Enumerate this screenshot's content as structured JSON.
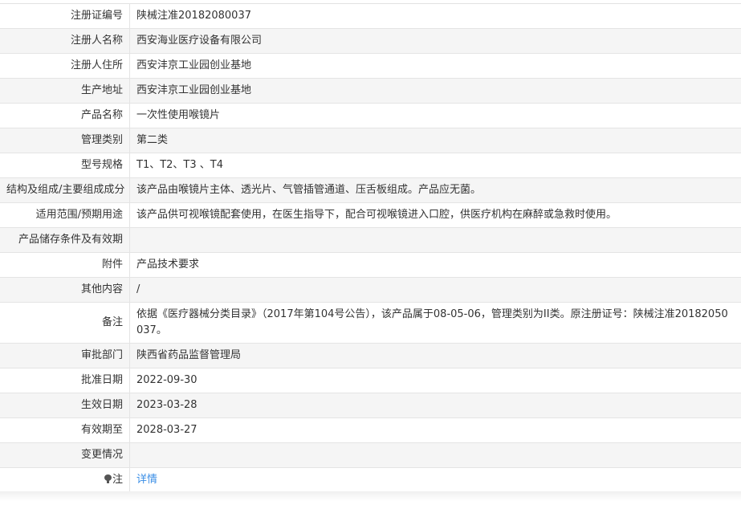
{
  "rows": [
    {
      "label": "注册证编号",
      "value": "陕械注准20182080037"
    },
    {
      "label": "注册人名称",
      "value": "西安海业医疗设备有限公司"
    },
    {
      "label": "注册人住所",
      "value": "西安沣京工业园创业基地"
    },
    {
      "label": "生产地址",
      "value": "西安沣京工业园创业基地"
    },
    {
      "label": "产品名称",
      "value": "一次性使用喉镜片"
    },
    {
      "label": "管理类别",
      "value": "第二类"
    },
    {
      "label": "型号规格",
      "value": "T1、T2、T3 、T4"
    },
    {
      "label": "结构及组成/主要组成成分",
      "value": "该产品由喉镜片主体、透光片、气管插管通道、压舌板组成。产品应无菌。"
    },
    {
      "label": "适用范围/预期用途",
      "value": "该产品供可视喉镜配套使用，在医生指导下，配合可视喉镜进入口腔，供医疗机构在麻醉或急救时使用。"
    },
    {
      "label": "产品储存条件及有效期",
      "value": ""
    },
    {
      "label": "附件",
      "value": "产品技术要求"
    },
    {
      "label": "其他内容",
      "value": "/"
    },
    {
      "label": "备注",
      "value": "依据《医疗器械分类目录》（2017年第104号公告），该产品属于08-05-06，管理类别为II类。原注册证号：陕械注准20182050037。"
    },
    {
      "label": "审批部门",
      "value": "陕西省药品监督管理局"
    },
    {
      "label": "批准日期",
      "value": "2022-09-30"
    },
    {
      "label": "生效日期",
      "value": "2023-03-28"
    },
    {
      "label": "有效期至",
      "value": "2028-03-27"
    },
    {
      "label": "变更情况",
      "value": ""
    }
  ],
  "note": {
    "icon": "bulb-icon",
    "label": "注",
    "link_text": "详情",
    "link_color": "#3a8ee6"
  }
}
